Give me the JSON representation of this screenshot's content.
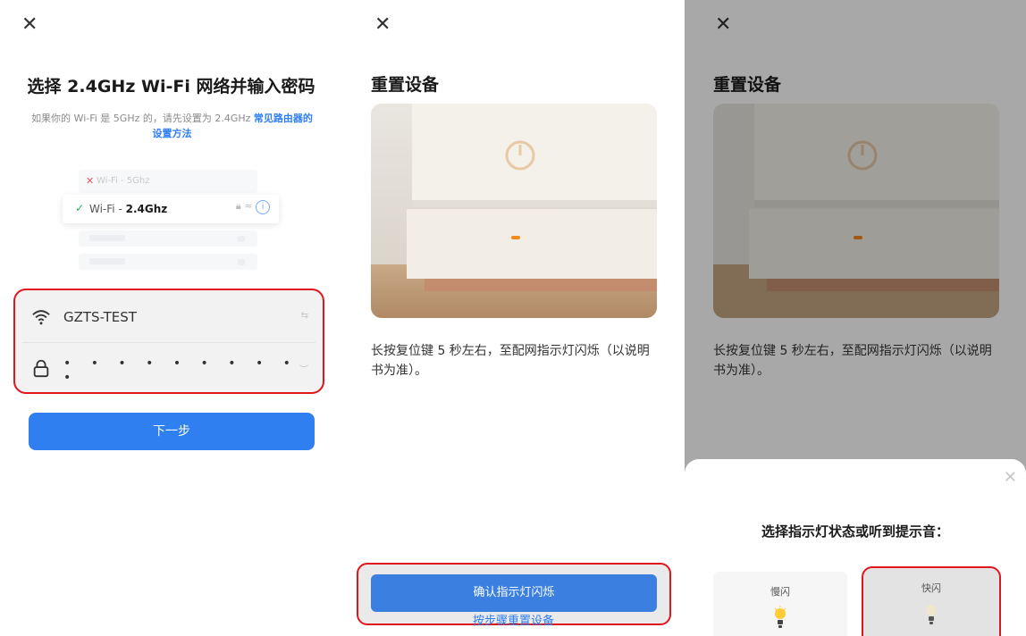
{
  "panel1": {
    "title": "选择 2.4GHz Wi-Fi 网络并输入密码",
    "subtitle_text": "如果你的 Wi-Fi 是 5GHz 的，请先设置为 2.4GHz ",
    "subtitle_link": "常见路由器的设置方法",
    "illustration": {
      "bad_network": "Wi-Fi - 5Ghz",
      "good_network_prefix": "Wi-Fi - ",
      "good_network_band": "2.4Ghz"
    },
    "ssid_value": "GZTS-TEST",
    "password_mask": "• • • • • • • • • •",
    "next_button": "下一步"
  },
  "panel2": {
    "title": "重置设备",
    "instruction": "长按复位键 5 秒左右，至配网指示灯闪烁（以说明书为准）。",
    "confirm_button": "确认指示灯闪烁",
    "reset_link": "按步骤重置设备"
  },
  "panel3": {
    "title": "重置设备",
    "instruction": "长按复位键 5 秒左右，至配网指示灯闪烁（以说明书为准）。",
    "sheet_title": "选择指示灯状态或听到提示音：",
    "option_slow": "慢闪",
    "option_fast": "快闪"
  },
  "colors": {
    "accent": "#2f7ff0",
    "highlight_border": "#e0161d"
  }
}
